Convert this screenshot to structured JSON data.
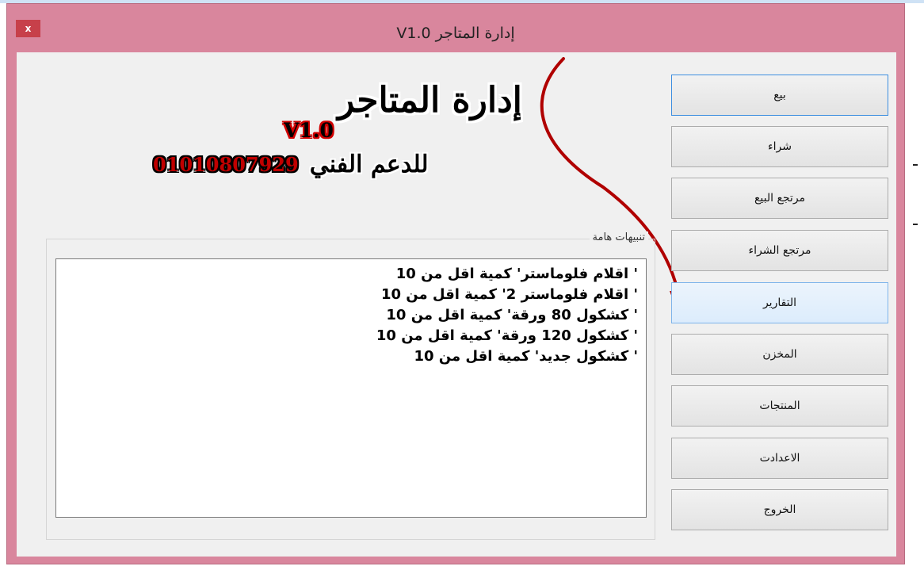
{
  "window": {
    "title": "إدارة المتاجر V1.0",
    "close_label": "x"
  },
  "logo": {
    "title": "إدارة المتاجر",
    "version": "V1.0",
    "support_label": "للدعم الفني",
    "support_phone": "01010807929"
  },
  "alerts": {
    "legend": "تنبيهات هامة",
    "lines": [
      "' اقلام فلوماستر'   كمية اقل من 10",
      "' اقلام فلوماستر 2'   كمية اقل من 10",
      "' كشكول 80 ورقة'   كمية اقل من 10",
      "' كشكول 120 ورقة'   كمية اقل من 10",
      "' كشكول جديد'   كمية اقل من 10"
    ]
  },
  "menu": {
    "items": [
      {
        "label": "بيع"
      },
      {
        "label": "شراء"
      },
      {
        "label": "مرتجع البيع"
      },
      {
        "label": "مرتجع الشراء"
      },
      {
        "label": "التقارير"
      },
      {
        "label": "المخزن"
      },
      {
        "label": "المنتجات"
      },
      {
        "label": "الاعدادت"
      },
      {
        "label": "الخروج"
      }
    ]
  },
  "colors": {
    "window_frame": "#d9869d",
    "close_button": "#c7404a",
    "arrow": "#b00000",
    "default_button_border": "#3c8ee0"
  }
}
